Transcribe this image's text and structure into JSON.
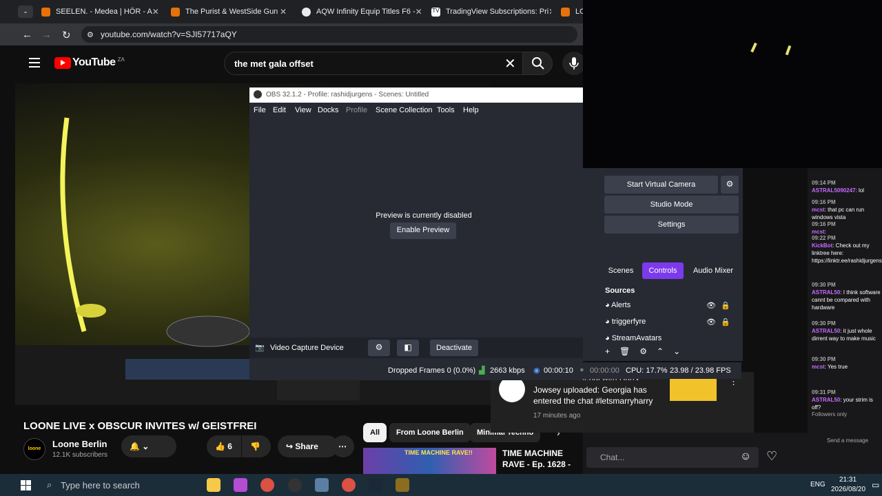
{
  "browser": {
    "tabs": [
      {
        "label": "SEELEN. - Medea | HÖR - A",
        "color": "#e8710a"
      },
      {
        "label": "The Purist & WestSide Gun",
        "color": "#e8710a"
      },
      {
        "label": "AQW Infinity Equip Titles F6 -",
        "color": "#e8eaed"
      },
      {
        "label": "TradingView Subscriptions: Pri",
        "color": "#e8eaed"
      },
      {
        "label": "LO",
        "color": "#e8710a"
      }
    ],
    "url": "youtube.com/watch?v=SJI57717aQY"
  },
  "youtube": {
    "logo": "YouTube",
    "region": "ZA",
    "search_query": "the met gala offset",
    "video_title": "LOONE LIVE x OBSCUR INVITES w/ GEISTFREI",
    "channel": "Loone Berlin",
    "subscribers": "12.1K subscribers",
    "channel_avatar_text": "loone",
    "likes": "6",
    "share": "Share",
    "chips": [
      "All",
      "From Loone Berlin",
      "Minimal Techno"
    ],
    "rec_title": "TIME MACHINE RAVE - Ep. 1628 -",
    "rec_thumb_text": "TIME MACHINE RAVE!!"
  },
  "notification": {
    "line0": "Boyfriend Material with Harry",
    "text": "Jowsey uploaded: Georgia has entered the chat #letsmarryharry",
    "time": "17 minutes ago"
  },
  "obs": {
    "title": "OBS 32.1.2 - Profile: rashidjurgens - Scenes: Untitled",
    "menu": [
      "File",
      "Edit",
      "View",
      "Docks",
      "Profile",
      "Scene Collection",
      "Tools",
      "Help"
    ],
    "preview_text": "Preview is currently disabled",
    "enable_preview": "Enable Preview",
    "source_name": "Video Capture Device",
    "deactivate": "Deactivate",
    "status": {
      "dropped": "Dropped Frames 0 (0.0%)",
      "kbps": "2663 kbps",
      "live_time": "00:00:10",
      "rec_time": "00:00:00",
      "cpu": "CPU: 17.7%",
      "fps": "23.98 / 23.98 FPS"
    },
    "controls": [
      "Start Virtual Camera",
      "Studio Mode",
      "Settings"
    ],
    "dock_tabs": [
      "Scenes",
      "Controls",
      "Audio Mixer"
    ],
    "sources_title": "Sources",
    "sources": [
      "Alerts",
      "triggerfyre",
      "StreamAvatars"
    ]
  },
  "chat": {
    "messages": [
      {
        "time": "09:14 PM",
        "user": "ASTRAL5090247",
        "text": ": lol"
      },
      {
        "time": "09:16 PM",
        "user": "mcst",
        "text": ": that pc can run windows vista"
      },
      {
        "time": "09:16 PM",
        "user": "mcst",
        "text": ":"
      },
      {
        "time": "09:22 PM",
        "user": "KickBot",
        "text": ": Check out my linktree here: https://linktr.ee/rashidjurgens"
      },
      {
        "time": "09:30 PM",
        "user": "ASTRAL50",
        "text": ": I think software cannt be compared with hardware"
      },
      {
        "time": "09:30 PM",
        "user": "ASTRAL50",
        "text": ": it just whole dirrent way to make music"
      },
      {
        "time": "09:30 PM",
        "user": "mcst",
        "text": ": Yes true"
      },
      {
        "time": "09:31 PM",
        "user": "ASTRAL50",
        "text": ": your strim is off?"
      }
    ],
    "followers_only": "Followers only",
    "send_placeholder": "Send a message",
    "chat_placeholder": "Chat..."
  },
  "taskbar": {
    "search_placeholder": "Type here to search",
    "lang": "ENG",
    "time": "21:31",
    "date": "2026/08/20"
  }
}
